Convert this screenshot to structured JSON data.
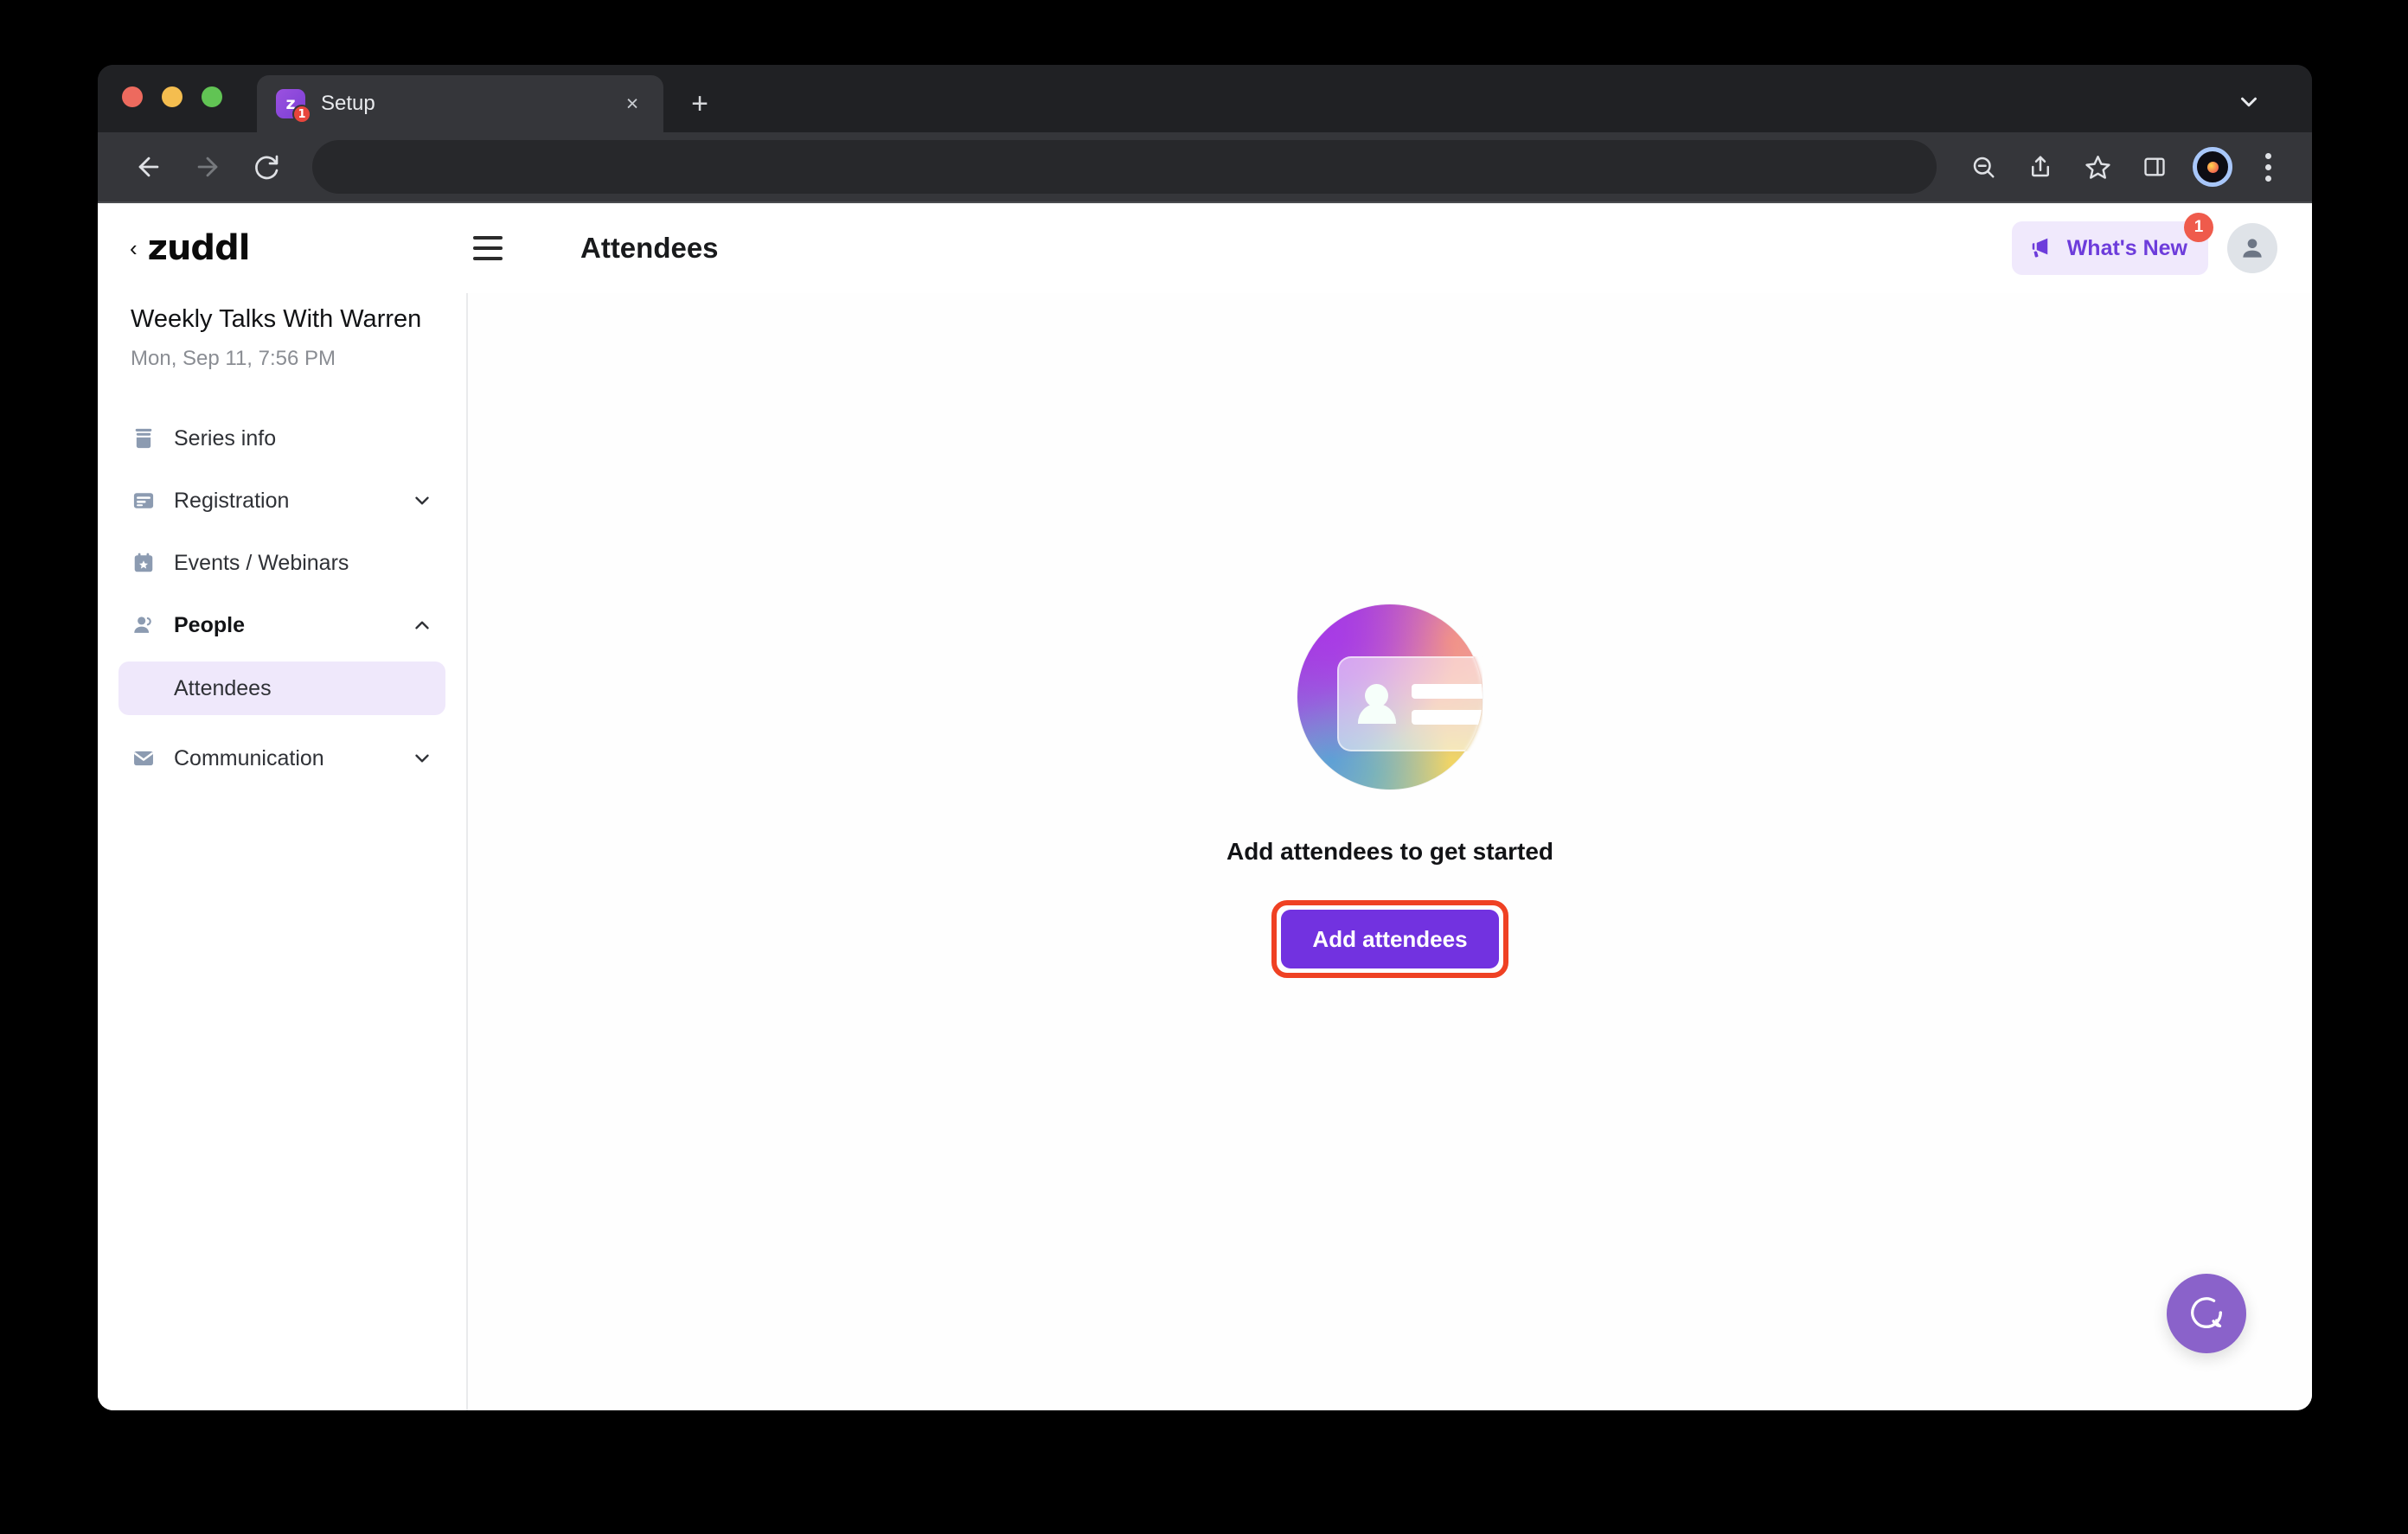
{
  "browser": {
    "tab": {
      "title": "Setup",
      "favicon_letter": "z",
      "favicon_badge": "1",
      "close_icon": "×"
    },
    "new_tab_icon": "+",
    "tab_list_icon": "chevron-down-icon",
    "toolbar": {
      "back_icon": "arrow-left-icon",
      "forward_icon": "arrow-right-icon",
      "reload_icon": "reload-icon",
      "address_value": "",
      "address_placeholder": "",
      "zoom_out_icon": "zoom-out-icon",
      "share_icon": "share-icon",
      "bookmark_icon": "star-icon",
      "side_panel_icon": "side-panel-icon",
      "profile_icon": "profile-avatar-icon",
      "menu_icon": "kebab-menu-icon"
    }
  },
  "app": {
    "brand": "zuddl",
    "back_chevron": "‹",
    "menu_icon": "hamburger-icon",
    "page_title": "Attendees",
    "whats_new": {
      "label": "What's New",
      "badge": "1",
      "icon": "megaphone-icon"
    },
    "account_icon": "user-avatar-icon"
  },
  "sidebar": {
    "event_title": "Weekly Talks With Warren",
    "event_date": "Mon, Sep 11, 7:56 PM",
    "items": [
      {
        "label": "Series info",
        "icon": "archive-icon",
        "expandable": false,
        "chevron": ""
      },
      {
        "label": "Registration",
        "icon": "form-icon",
        "expandable": true,
        "chevron": "chevron-down-icon"
      },
      {
        "label": "Events / Webinars",
        "icon": "calendar-star-icon",
        "expandable": false,
        "chevron": ""
      },
      {
        "label": "People",
        "icon": "people-icon",
        "expandable": true,
        "chevron": "chevron-up-icon"
      },
      {
        "label": "Communication",
        "icon": "envelope-icon",
        "expandable": true,
        "chevron": "chevron-down-icon"
      }
    ],
    "people_children": [
      {
        "label": "Attendees",
        "selected": true
      }
    ]
  },
  "content": {
    "empty_state": {
      "illustration": "attendee-badge-card-illustration",
      "heading": "Add attendees to get started",
      "cta_label": "Add attendees"
    },
    "help_bubble_icon": "chat-bubble-icon"
  },
  "colors": {
    "accent_purple": "#7232e0",
    "whats_new_purple": "#6d3cdb",
    "whats_new_bg": "#f0e9fc",
    "selected_nav_bg": "#efe8fb",
    "badge_red": "#ef5b4c",
    "highlight_red": "#ef4123",
    "help_bubble": "#8a62ca",
    "browser_chrome": "#35363a",
    "tab_strip": "#202124"
  }
}
